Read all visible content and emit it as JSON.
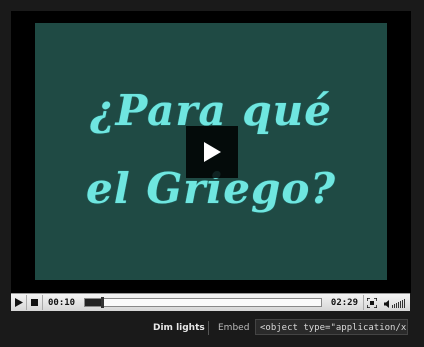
{
  "video": {
    "title_line1": "¿Para qué",
    "title_line2": "el Griego?"
  },
  "controls": {
    "elapsed": "00:10",
    "duration": "02:29",
    "progress_fraction": 0.07
  },
  "footer": {
    "dim_lights": "Dim lights",
    "embed_label": "Embed",
    "embed_code": "<object type=\"application/x-shoc"
  },
  "colors": {
    "video_bg": "#1f4a44",
    "title_text": "#6fe6e0"
  }
}
